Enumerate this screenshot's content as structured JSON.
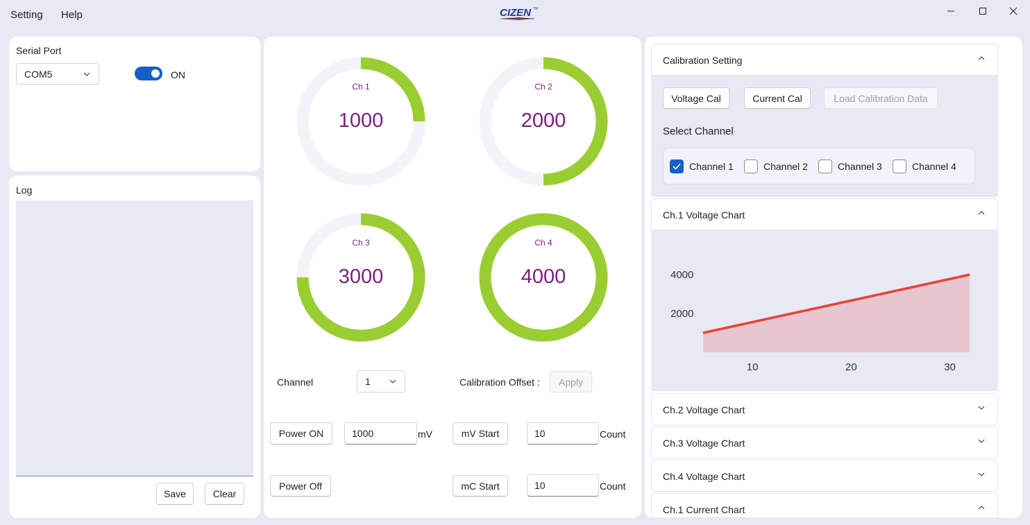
{
  "menu": {
    "setting": "Setting",
    "help": "Help"
  },
  "brand": {
    "logo_text": "CIZEN"
  },
  "serial": {
    "title": "Serial Port",
    "port_value": "COM5",
    "toggle_on": true,
    "toggle_label": "ON"
  },
  "log": {
    "title": "Log",
    "content": "",
    "save_label": "Save",
    "clear_label": "Clear"
  },
  "gauges": [
    {
      "channel": "Ch 1",
      "value": "1000",
      "fraction": 0.25
    },
    {
      "channel": "Ch 2",
      "value": "2000",
      "fraction": 0.5
    },
    {
      "channel": "Ch 3",
      "value": "3000",
      "fraction": 0.75
    },
    {
      "channel": "Ch 4",
      "value": "4000",
      "fraction": 1.0
    }
  ],
  "controls": {
    "channel_label": "Channel",
    "channel_value": "1",
    "calibration_offset_label": "Calibration Offset :",
    "apply_label": "Apply",
    "power_on_label": "Power ON",
    "power_on_value": "1000",
    "power_on_unit": "mV",
    "mv_start_label": "mV Start",
    "mv_count_value": "10",
    "count_label": "Count",
    "power_off_label": "Power Off",
    "mc_start_label": "mC Start",
    "mc_count_value": "10"
  },
  "calibration": {
    "title": "Calibration Setting",
    "voltage_cal": "Voltage Cal",
    "current_cal": "Current Cal",
    "load_data": "Load Calibration Data",
    "select_channel_label": "Select Channel",
    "channels": [
      {
        "label": "Channel 1",
        "checked": true
      },
      {
        "label": "Channel 2",
        "checked": false
      },
      {
        "label": "Channel 3",
        "checked": false
      },
      {
        "label": "Channel 4",
        "checked": false
      }
    ]
  },
  "expanders": {
    "ch1_voltage": "Ch.1 Voltage Chart",
    "ch2_voltage": "Ch.2 Voltage Chart",
    "ch3_voltage": "Ch.3 Voltage Chart",
    "ch4_voltage": "Ch.4 Voltage Chart",
    "ch1_current": "Ch.1 Current Chart"
  },
  "colors": {
    "gauge_fill": "#9acd32",
    "gauge_track": "#f3f3f9",
    "gauge_text": "#7a1f7d",
    "accent": "#1460c7",
    "line": "#e8413a",
    "area": "#e8c6cf"
  },
  "chart_data": {
    "type": "area",
    "title": "",
    "xlabel": "",
    "ylabel": "",
    "x": [
      5,
      32
    ],
    "series": [
      {
        "values": [
          1000,
          4000
        ]
      }
    ],
    "xticks": [
      "10",
      "20",
      "30"
    ],
    "xtick_values": [
      10,
      20,
      30
    ],
    "yticks": [
      "2000",
      "4000"
    ],
    "ytick_values": [
      2000,
      4000
    ],
    "xlim": [
      5,
      32
    ],
    "ylim": [
      0,
      4000
    ],
    "grid": false,
    "legend": "none"
  }
}
